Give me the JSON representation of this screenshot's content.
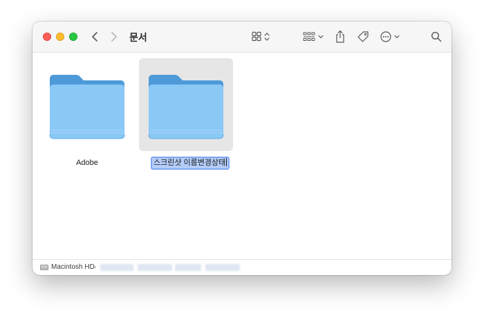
{
  "window": {
    "title": "문서",
    "traffic_lights": {
      "close": "#fe5f57",
      "minimize": "#febc2e",
      "maximize": "#28c840"
    }
  },
  "toolbar": {
    "icons": [
      "chevron-left-icon",
      "chevron-right-icon",
      "grid-view-icon",
      "group-icon",
      "share-icon",
      "tag-icon",
      "more-icon",
      "search-icon"
    ]
  },
  "items": [
    {
      "name": "Adobe",
      "selected": false
    },
    {
      "name": "스크린샷 이름변경상태",
      "selected": true,
      "editing": true
    }
  ],
  "pathbar": {
    "volume": "Macintosh HD",
    "separator": "›"
  },
  "colors": {
    "folder_body": "#8ac8f6",
    "folder_tab": "#4e9ad9",
    "selection_bg": "#e6e6e6",
    "edit_highlight": "#b4cdf9"
  }
}
